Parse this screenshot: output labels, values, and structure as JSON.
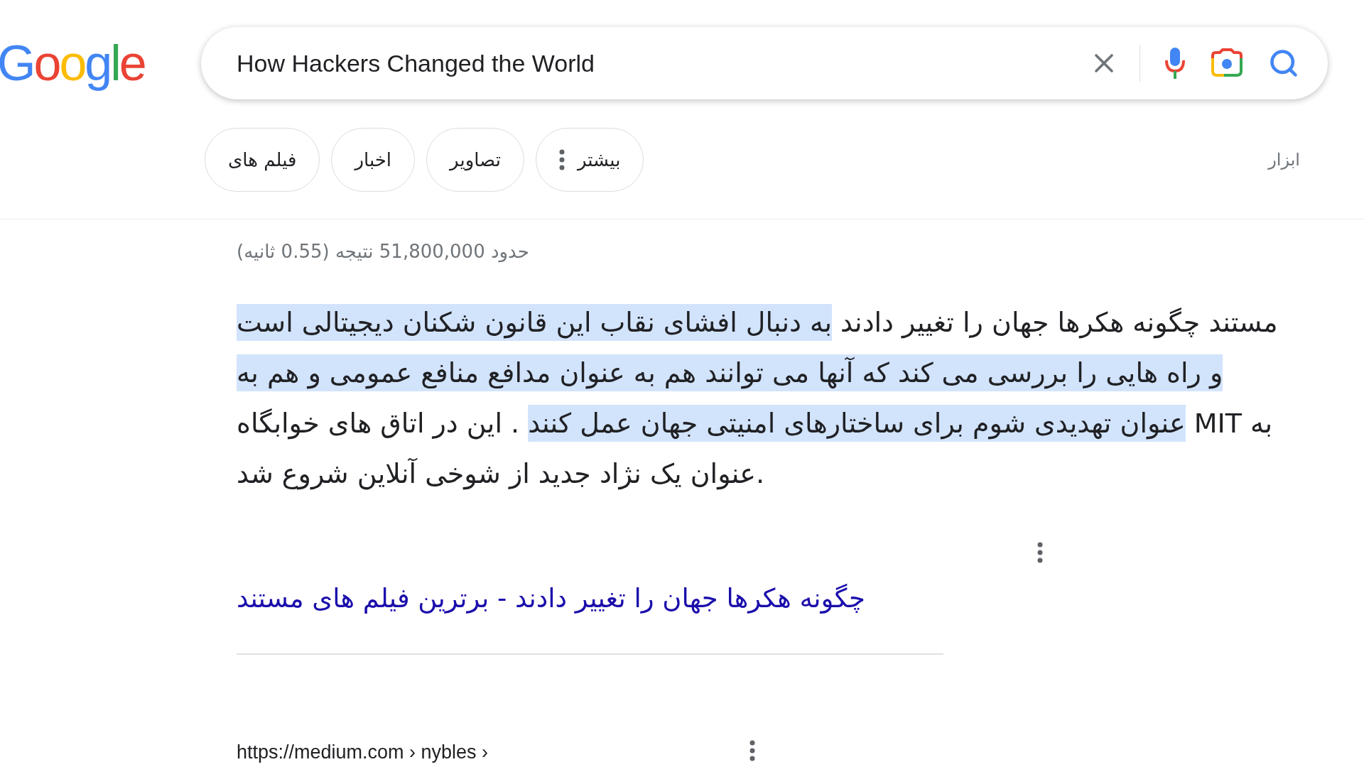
{
  "logo": "Google",
  "search": {
    "value": "How Hackers Changed the World"
  },
  "chips": [
    {
      "label": "بیشتر",
      "kind": "menu"
    },
    {
      "label": "تصاویر",
      "kind": "plain"
    },
    {
      "label": "اخبار",
      "kind": "plain"
    },
    {
      "label": "فیلم های",
      "kind": "plain"
    }
  ],
  "tools": "ابزار",
  "result_stats": "حدود 51,800,000 نتیجه (0.55 ثانیه)",
  "snippet": [
    {
      "text": "مستند چگونه هکرها جهان را تغییر دادند ",
      "highlighted": false
    },
    {
      "text": "به دنبال افشای نقاب این قانون شکنان دیجیتالی است و راه هایی را بررسی می کند که آنها می توانند هم به عنوان مدافع منافع عمومی و هم به عنوان تهدیدی شوم برای ساختارهای امنیتی جهان عمل کنند",
      "highlighted": true
    },
    {
      "text": " . این در اتاق های خوابگاه MIT به عنوان یک نژاد جدید از شوخی آنلاین شروع شد.",
      "highlighted": false
    }
  ],
  "result_title": "چگونه هکرها جهان را تغییر دادند - برترین فیلم های مستند",
  "next_result_url": "https://medium.com › nybles ›"
}
